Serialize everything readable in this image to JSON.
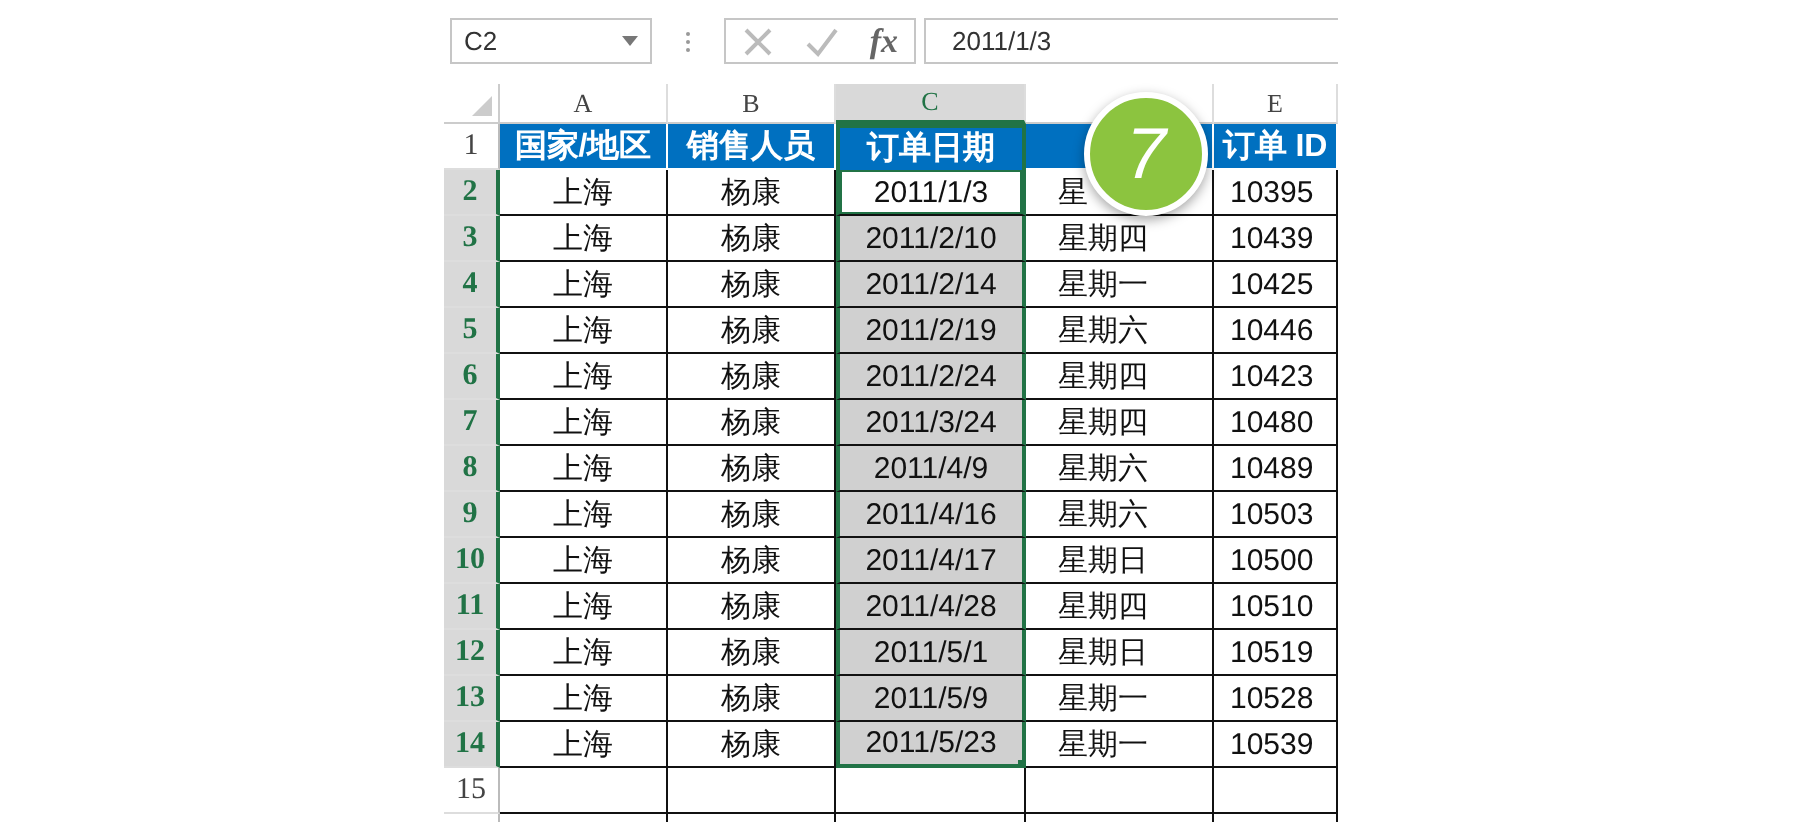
{
  "formula_bar": {
    "name_box": "C2",
    "function_label": "fx",
    "value": "2011/1/3"
  },
  "columns": [
    {
      "label": "A",
      "selected": false
    },
    {
      "label": "B",
      "selected": false
    },
    {
      "label": "C",
      "selected": true
    },
    {
      "selected": false
    },
    {
      "label": "E",
      "selected": false
    }
  ],
  "header_row": {
    "row": "1",
    "cells": [
      {
        "text": "国家/地区"
      },
      {
        "text": "销售人员"
      },
      {
        "text": "订单日期"
      },
      {},
      {
        "text": "订单 ID"
      }
    ]
  },
  "rows": [
    {
      "row": "2",
      "selected": true,
      "active": true,
      "cells": [
        "上海",
        "杨康",
        "2011/1/3",
        "星",
        "10395"
      ]
    },
    {
      "row": "3",
      "selected": true,
      "active": false,
      "cells": [
        "上海",
        "杨康",
        "2011/2/10",
        "星期四",
        "10439"
      ]
    },
    {
      "row": "4",
      "selected": true,
      "active": false,
      "cells": [
        "上海",
        "杨康",
        "2011/2/14",
        "星期一",
        "10425"
      ]
    },
    {
      "row": "5",
      "selected": true,
      "active": false,
      "cells": [
        "上海",
        "杨康",
        "2011/2/19",
        "星期六",
        "10446"
      ]
    },
    {
      "row": "6",
      "selected": true,
      "active": false,
      "cells": [
        "上海",
        "杨康",
        "2011/2/24",
        "星期四",
        "10423"
      ]
    },
    {
      "row": "7",
      "selected": true,
      "active": false,
      "cells": [
        "上海",
        "杨康",
        "2011/3/24",
        "星期四",
        "10480"
      ]
    },
    {
      "row": "8",
      "selected": true,
      "active": false,
      "cells": [
        "上海",
        "杨康",
        "2011/4/9",
        "星期六",
        "10489"
      ]
    },
    {
      "row": "9",
      "selected": true,
      "active": false,
      "cells": [
        "上海",
        "杨康",
        "2011/4/16",
        "星期六",
        "10503"
      ]
    },
    {
      "row": "10",
      "selected": true,
      "active": false,
      "cells": [
        "上海",
        "杨康",
        "2011/4/17",
        "星期日",
        "10500"
      ]
    },
    {
      "row": "11",
      "selected": true,
      "active": false,
      "cells": [
        "上海",
        "杨康",
        "2011/4/28",
        "星期四",
        "10510"
      ]
    },
    {
      "row": "12",
      "selected": true,
      "active": false,
      "cells": [
        "上海",
        "杨康",
        "2011/5/1",
        "星期日",
        "10519"
      ]
    },
    {
      "row": "13",
      "selected": true,
      "active": false,
      "cells": [
        "上海",
        "杨康",
        "2011/5/9",
        "星期一",
        "10528"
      ]
    },
    {
      "row": "14",
      "selected": true,
      "active": false,
      "cells": [
        "上海",
        "杨康",
        "2011/5/23",
        "星期一",
        "10539"
      ]
    },
    {
      "row": "15",
      "selected": false,
      "active": false,
      "cells": []
    }
  ],
  "step_badge": "7"
}
